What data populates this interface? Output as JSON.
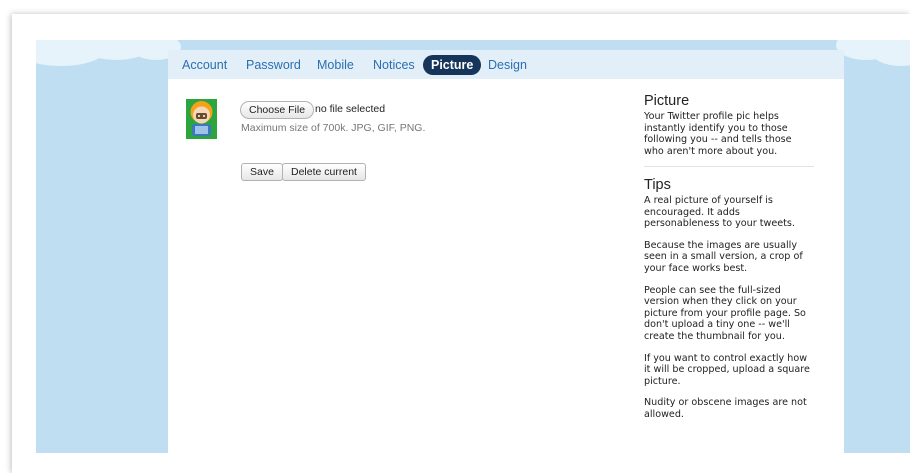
{
  "tabs": [
    {
      "label": "Account",
      "active": false
    },
    {
      "label": "Password",
      "active": false
    },
    {
      "label": "Mobile",
      "active": false
    },
    {
      "label": "Notices",
      "active": false
    },
    {
      "label": "Picture",
      "active": true
    },
    {
      "label": "Design",
      "active": false
    }
  ],
  "upload": {
    "choose_label": "Choose File",
    "file_status": "no file selected",
    "hint": "Maximum size of 700k. JPG, GIF, PNG.",
    "save_label": "Save",
    "delete_label": "Delete current"
  },
  "sidebar": {
    "picture_title": "Picture",
    "picture_text": "Your Twitter profile pic helps instantly identify you to those following you -- and tells those who aren't more about you.",
    "tips_title": "Tips",
    "tips": [
      "A real picture of yourself is encouraged. It adds personableness to your tweets.",
      "Because the images are usually seen in a small version, a crop of your face works best.",
      "People can see the full-sized version when they click on your picture from your profile page. So don't upload a tiny one -- we'll create the thumbnail for you.",
      "If you want to control exactly how it will be cropped, upload a square picture.",
      "Nudity or obscene images are not allowed."
    ]
  },
  "colors": {
    "sky": "#c0def1",
    "tabbar": "#e3eff8",
    "link": "#2a6fb0",
    "active_tab": "#16355a",
    "avatar_bg": "#2ea43e"
  }
}
